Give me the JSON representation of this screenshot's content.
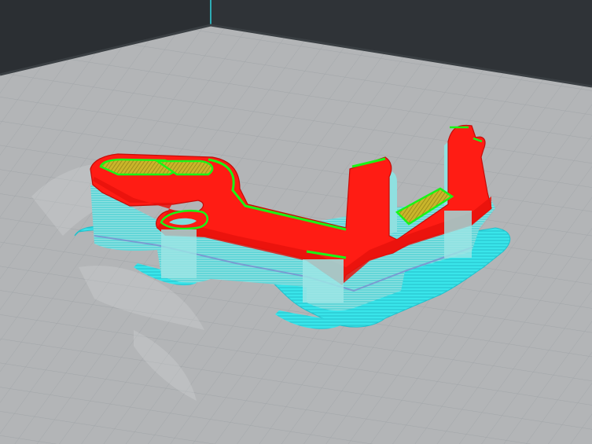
{
  "viewport": {
    "view": "layer-preview",
    "background_color": "#24282b",
    "build_plate_color": "#b4b6b8",
    "grid_line_color": "#9fa3a6",
    "plate_edge_color": "#2fd6e0"
  },
  "model": {
    "colors": {
      "outer_wall": "#ff1a14",
      "inner_wall": "#19f516",
      "top_bottom_skin": "#c8b22a",
      "support": "#59d9dc",
      "support_light": "#9ae6e6",
      "brim": "#3fe8ec",
      "support_interface": "#7a8ccf"
    }
  }
}
